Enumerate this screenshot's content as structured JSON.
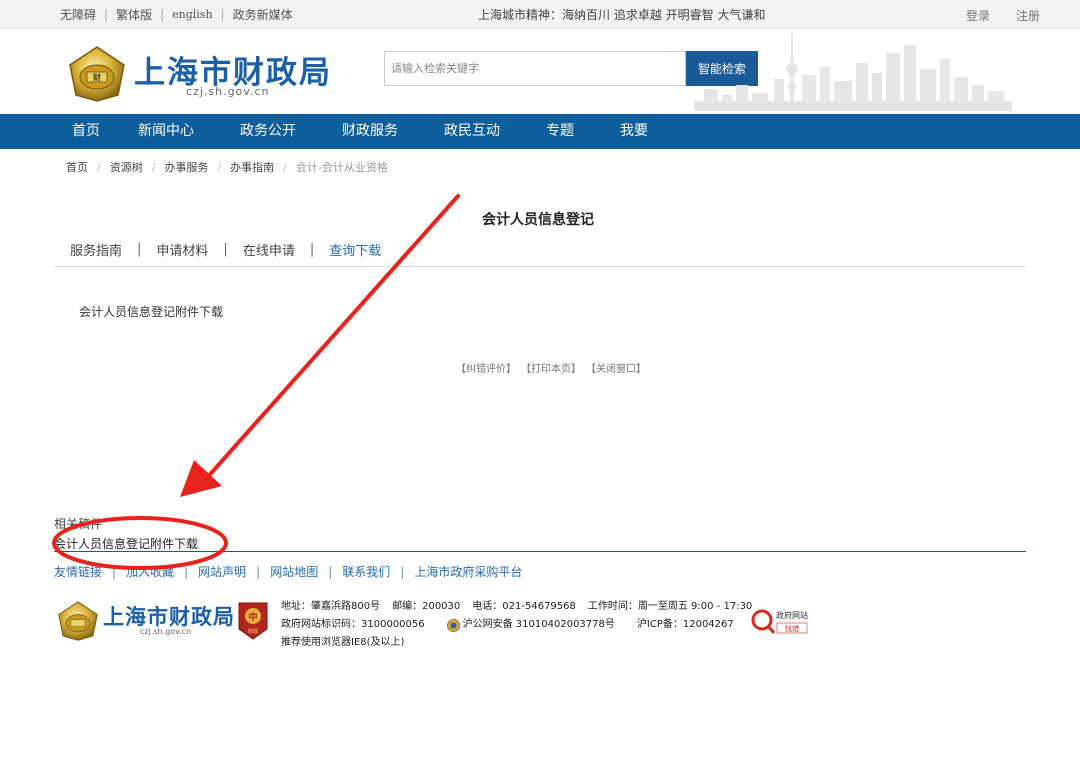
{
  "topbar": {
    "links": [
      "无障碍",
      "繁体版",
      "english",
      "政务新媒体"
    ],
    "slogan": "上海城市精神：海纳百川  追求卓越  开明睿智  大气谦和",
    "login": "登录",
    "register": "注册"
  },
  "header": {
    "site_title": "上海市财政局",
    "site_url": "czj.sh.gov.cn",
    "search_placeholder": "请输入检索关键字",
    "search_button": "智能检索"
  },
  "nav": {
    "items": [
      "首页",
      "新闻中心",
      "政务公开",
      "财政服务",
      "政民互动",
      "专题",
      "我要"
    ]
  },
  "breadcrumb": {
    "items": [
      "首页",
      "资源树",
      "办事服务",
      "办事指南"
    ],
    "current": "会计-会计从业资格"
  },
  "main": {
    "title": "会计人员信息登记",
    "tabs": [
      "服务指南",
      "申请材料",
      "在线申请",
      "查询下载"
    ],
    "active_tab": "查询下载",
    "content": "会计人员信息登记附件下载",
    "actions": [
      "【纠错评价】",
      "【打印本页】",
      "【关闭窗口】"
    ]
  },
  "related": {
    "title": "相关稿件",
    "item": "会计人员信息登记附件下载"
  },
  "footer": {
    "links": [
      "友情链接",
      "加入收藏",
      "网站声明",
      "网站地图",
      "联系我们",
      "上海市政府采购平台"
    ],
    "site_title": "上海市财政局",
    "site_url": "czj.sh.gov.cn",
    "badge_text": "财政",
    "address": "地址：肇嘉浜路800号",
    "postcode": "邮编：200030",
    "phone": "电话：021-54679568",
    "hours": "工作时间：周一至周五 9:00 - 17:30",
    "gov_id": "政府网站标识码：3100000056",
    "police": "沪公网安备 31010402003778号",
    "icp": "沪ICP备：12004267",
    "browser": "推荐使用浏览器IE8(及以上)",
    "gov_find_line1": "政府网站",
    "gov_find_line2": "找错"
  },
  "colors": {
    "nav_blue": "#0f5e9c",
    "brand_blue": "#1b5fa7",
    "annotation_red": "#e8231c"
  }
}
